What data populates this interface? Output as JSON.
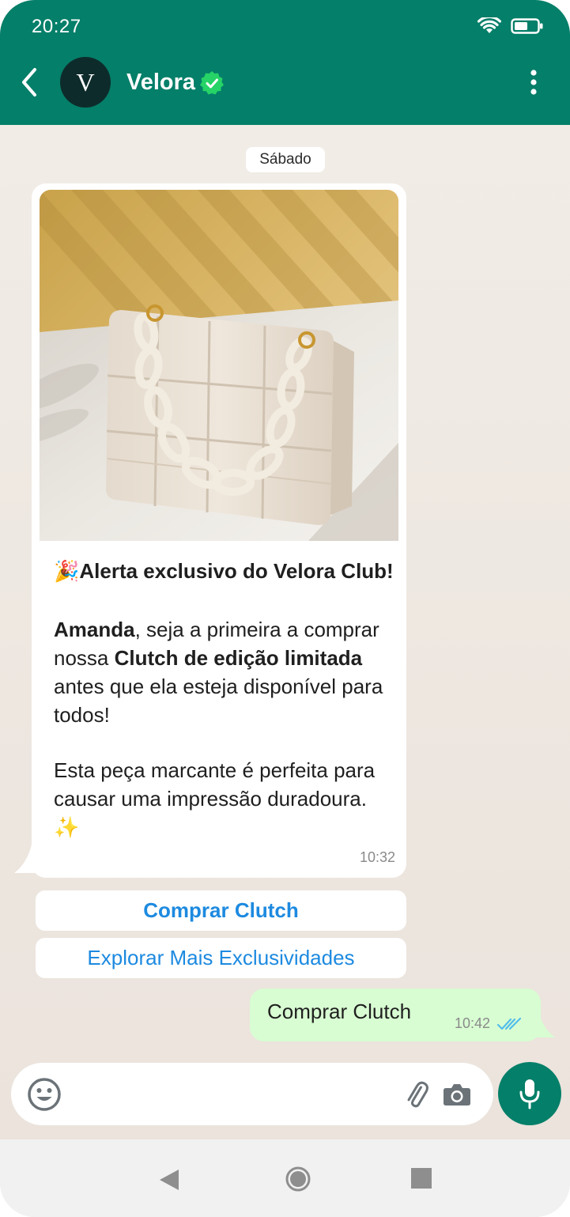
{
  "status_bar": {
    "time": "20:27"
  },
  "header": {
    "contact_name": "Velora",
    "avatar_letter": "V",
    "accent_color": "#047f69"
  },
  "chat": {
    "date_chip": "Sábado",
    "incoming_message": {
      "title": "Alerta exclusivo do Velora Club!",
      "title_emoji": "🎉",
      "para1_name": "Amanda",
      "para1_a": ", seja a primeira a comprar nossa ",
      "para1_product": "Clutch de edição limitada",
      "para1_b": " antes que ela esteja disponível para todos!",
      "para2": "Esta peça marcante é perfeita para causar uma impressão duradoura.",
      "para2_emoji": "✨",
      "time": "10:32"
    },
    "quick_replies": [
      "Comprar Clutch",
      "Explorar Mais Exclusividades"
    ],
    "outgoing_message": {
      "text": "Comprar Clutch",
      "time": "10:42",
      "status": "read"
    }
  },
  "input": {
    "placeholder": ""
  },
  "icons": {
    "back": "back-arrow-icon",
    "verified": "verified-badge-icon",
    "menu": "more-vert-icon",
    "emoji": "emoji-icon",
    "attach": "paperclip-icon",
    "camera": "camera-icon",
    "mic": "mic-icon"
  }
}
